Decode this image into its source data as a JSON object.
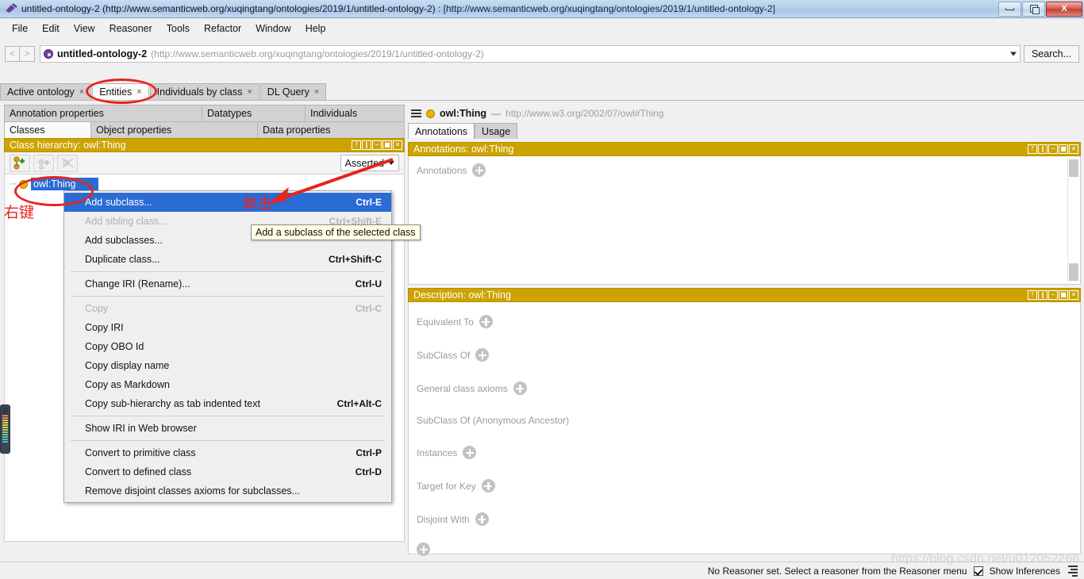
{
  "window": {
    "title_main": "untitled-ontology-2 (http://www.semanticweb.org/xuqingtang/ontologies/2019/1/untitled-ontology-2)",
    "title_suffix": " : [http://www.semanticweb.org/xuqingtang/ontologies/2019/1/untitled-ontology-2]",
    "minimize_label": "–",
    "restore_label": "❐",
    "close_label": "X"
  },
  "menubar": {
    "items": [
      {
        "label": "File"
      },
      {
        "label": "Edit"
      },
      {
        "label": "View"
      },
      {
        "label": "Reasoner"
      },
      {
        "label": "Tools"
      },
      {
        "label": "Refactor"
      },
      {
        "label": "Window"
      },
      {
        "label": "Help"
      }
    ]
  },
  "addressbar": {
    "back_label": "<",
    "forward_label": ">",
    "ontology_name": "untitled-ontology-2",
    "ontology_iri": "(http://www.semanticweb.org/xuqingtang/ontologies/2019/1/untitled-ontology-2)",
    "search_label": "Search..."
  },
  "tabs": [
    {
      "label": "Active ontology",
      "close": "×",
      "active": false
    },
    {
      "label": "Entities",
      "close": "×",
      "active": true
    },
    {
      "label": "Individuals by class",
      "close": "×",
      "active": false
    },
    {
      "label": "DL Query",
      "close": "×",
      "active": false
    }
  ],
  "left": {
    "prop_tabs_top": [
      {
        "label": "Annotation properties"
      },
      {
        "label": "Datatypes"
      },
      {
        "label": "Individuals"
      }
    ],
    "prop_tabs_bottom": [
      {
        "label": "Classes",
        "active": true
      },
      {
        "label": "Object properties",
        "active": false
      },
      {
        "label": "Data properties",
        "active": false
      }
    ],
    "panel_title": "Class hierarchy: owl:Thing",
    "header_icons": [
      "?",
      "‖",
      "─",
      "■",
      "✕"
    ],
    "toolbar": {
      "add_subclass_icon": "add-subclass-icon",
      "add_sibling_icon": "add-sibling-icon",
      "delete_icon": "delete-class-icon",
      "view_mode": "Asserted"
    },
    "tree": {
      "indent_marker": "···",
      "root_label": "owl:Thing"
    }
  },
  "context_menu": {
    "items": [
      {
        "label": "Add subclass...",
        "accel": "Ctrl-E",
        "state": "selected"
      },
      {
        "label": "Add sibling class...",
        "accel": "Ctrl+Shift-E",
        "state": "disabled"
      },
      {
        "label": "Add subclasses...",
        "accel": "",
        "state": "normal"
      },
      {
        "label": "Duplicate class...",
        "accel": "Ctrl+Shift-C",
        "state": "normal"
      },
      {
        "separator": true
      },
      {
        "label": "Change IRI (Rename)...",
        "accel": "Ctrl-U",
        "state": "normal"
      },
      {
        "separator": true
      },
      {
        "label": "Copy",
        "accel": "Ctrl-C",
        "state": "disabled"
      },
      {
        "label": "Copy IRI",
        "accel": "",
        "state": "normal"
      },
      {
        "label": "Copy OBO Id",
        "accel": "",
        "state": "normal"
      },
      {
        "label": "Copy display name",
        "accel": "",
        "state": "normal"
      },
      {
        "label": "Copy as Markdown",
        "accel": "",
        "state": "normal"
      },
      {
        "label": "Copy sub-hierarchy as tab indented text",
        "accel": "Ctrl+Alt-C",
        "state": "normal"
      },
      {
        "separator": true
      },
      {
        "label": "Show IRI in Web browser",
        "accel": "",
        "state": "normal"
      },
      {
        "separator": true
      },
      {
        "label": "Convert to primitive class",
        "accel": "Ctrl-P",
        "state": "normal"
      },
      {
        "label": "Convert to defined class",
        "accel": "Ctrl-D",
        "state": "normal"
      },
      {
        "label": "Remove disjoint classes axioms for subclasses...",
        "accel": "",
        "state": "normal"
      }
    ]
  },
  "tooltip": {
    "text": "Add a subclass of the selected class"
  },
  "right": {
    "entity_name": "owl:Thing",
    "entity_dash": "—",
    "entity_iri": "http://www.w3.org/2002/07/owl#Thing",
    "sub_tabs": [
      {
        "label": "Annotations",
        "active": true
      },
      {
        "label": "Usage",
        "active": false
      }
    ],
    "annotations_panel": {
      "title": "Annotations: owl:Thing",
      "header_icons": [
        "?",
        "‖",
        "─",
        "■",
        "✕"
      ],
      "row_label": "Annotations"
    },
    "description_panel": {
      "title": "Description: owl:Thing",
      "header_icons": [
        "?",
        "‖",
        "─",
        "■",
        "✕"
      ],
      "rows": [
        {
          "label": "Equivalent To",
          "has_plus": true
        },
        {
          "label": "SubClass Of",
          "has_plus": true
        },
        {
          "label": "General class axioms",
          "has_plus": true
        },
        {
          "label": "SubClass Of (Anonymous Ancestor)",
          "has_plus": false
        },
        {
          "label": "Instances",
          "has_plus": true
        },
        {
          "label": "Target for Key",
          "has_plus": true
        },
        {
          "label": "Disjoint With",
          "has_plus": true
        }
      ]
    }
  },
  "statusbar": {
    "message": "No Reasoner set. Select a reasoner from the Reasoner menu",
    "show_inferences_label": "Show Inferences",
    "show_inferences_checked": true
  },
  "annotations": {
    "right_click_note": "右键",
    "click_note": "单击"
  },
  "watermark": {
    "text": "https://blog.csdn.net/u012052268"
  },
  "colors": {
    "panel_header": "#cca300",
    "selection": "#2a6bd4",
    "annotation_red": "#e8241c",
    "owl_dot": "#e8b600"
  }
}
